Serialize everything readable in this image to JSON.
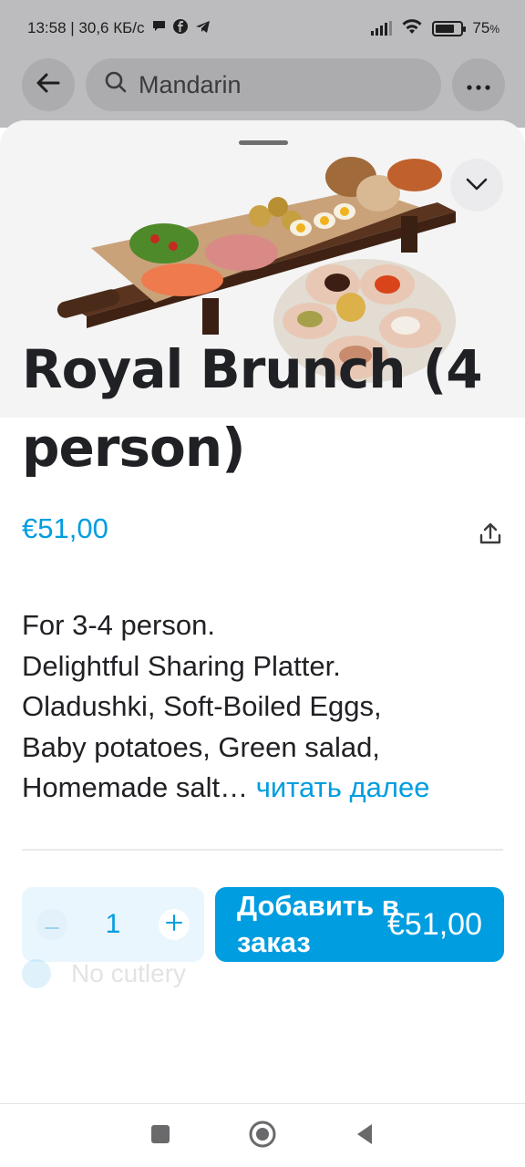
{
  "status_bar": {
    "time_and_speed": "13:58 | 30,6 КБ/с",
    "battery": "75",
    "battery_percent_sign": "%",
    "battery_level": 0.75,
    "icons": [
      "chat-bubble-icon",
      "facebook-icon",
      "telegram-icon",
      "signal-icon",
      "wifi-icon",
      "battery-icon"
    ]
  },
  "search": {
    "query": "Mandarin"
  },
  "product": {
    "title": "Royal Brunch (4 person)",
    "price": "€51,00",
    "description_lines": [
      "For 3-4 person.",
      "Delightful Sharing Platter.",
      "Oladushki, Soft-Boiled Eggs,",
      "Baby potatoes, Green salad,",
      "Homemade salt…"
    ],
    "read_more": "читать далее"
  },
  "order": {
    "quantity": "1",
    "add_label": "Добавить в заказ",
    "add_price": "€51,00",
    "cutlery_label": "No cutlery"
  },
  "colors": {
    "accent": "#009de0",
    "text": "#202125",
    "stepper_bg": "#eaf6fd"
  }
}
